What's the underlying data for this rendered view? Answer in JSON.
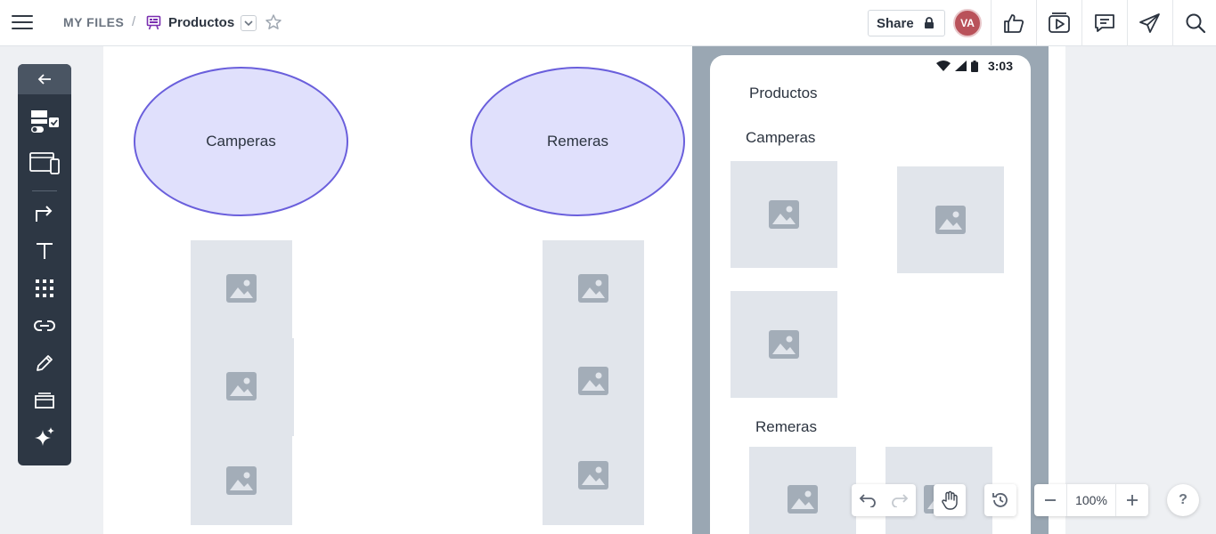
{
  "header": {
    "root_label": "MY FILES",
    "separator": "/",
    "doc_title": "Productos",
    "share_label": "Share",
    "avatar_initials": "VA"
  },
  "canvas": {
    "left_ellipse_label": "Camperas",
    "right_ellipse_label": "Remeras"
  },
  "phone": {
    "time": "3:03",
    "title": "Productos",
    "section_1": "Camperas",
    "section_2": "Remeras"
  },
  "controls": {
    "zoom": "100%",
    "help": "?"
  },
  "colors": {
    "accent": "#6a5fdc",
    "ellipse_fill": "#e0e0fc",
    "toolbar_bg": "#2d3744",
    "avatar_bg": "#b9525a",
    "doc_icon": "#7a2fb0"
  }
}
